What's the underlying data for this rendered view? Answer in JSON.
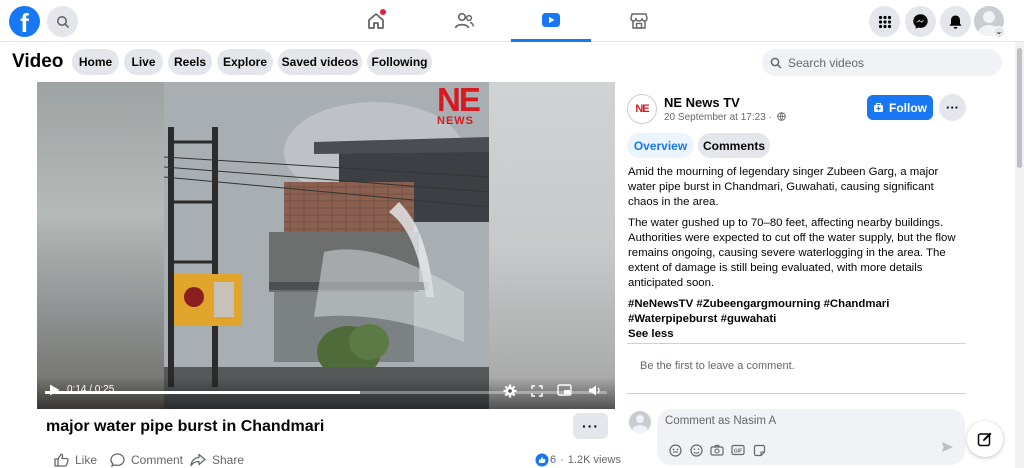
{
  "nav": {
    "logo": "f",
    "tabs": [
      "home",
      "friends",
      "video",
      "marketplace"
    ],
    "active_tab": "video",
    "home_notification": true
  },
  "header": {
    "title": "Video",
    "pills": [
      "Home",
      "Live",
      "Reels",
      "Explore",
      "Saved videos",
      "Following"
    ],
    "search_placeholder": "Search videos"
  },
  "video": {
    "overlay_logo_top": "NE",
    "overlay_logo_bottom": "NEWS",
    "time": "0:14 / 0:25",
    "progress": 0.56,
    "title": "major water pipe burst in Chandmari",
    "more": "···"
  },
  "actions": {
    "like": "Like",
    "comment": "Comment",
    "share": "Share",
    "reactions": "6",
    "views": "1.2K views"
  },
  "post": {
    "avatar_text": "NE",
    "page_name": "NE News TV",
    "date": "20 September at 17:23 ·",
    "follow": "Follow",
    "more": "···",
    "tabs": {
      "overview": "Overview",
      "comments": "Comments"
    },
    "paragraphs": [
      "Amid the mourning of legendary singer Zubeen Garg, a major water pipe burst in Chandmari, Guwahati, causing significant chaos in the area.",
      "The water gushed up to 70–80 feet, affecting nearby buildings. Authorities were expected to cut off the water supply, but the flow remains ongoing, causing severe waterlogging in the area. The extent of damage is still being evaluated, with more details anticipated soon."
    ],
    "hashtags": "#NeNewsTV #Zubeengargmourning #Chandmari #Waterpipeburst #guwahati",
    "see_less": "See less",
    "empty_comments": "Be the first to leave a comment.",
    "comment_placeholder": "Comment as Nasim A"
  },
  "colors": {
    "brand": "#1877f2",
    "logo_red": "#d71920"
  }
}
